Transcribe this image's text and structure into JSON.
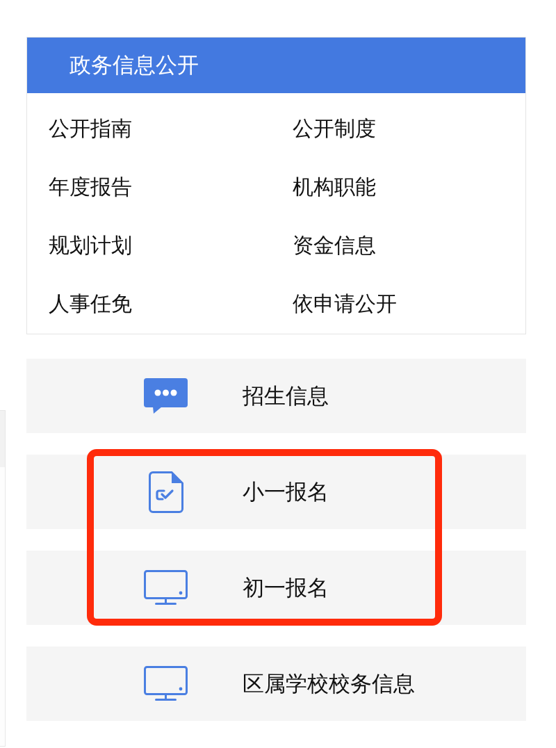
{
  "panel": {
    "title": "政务信息公开",
    "links": [
      "公开指南",
      "公开制度",
      "年度报告",
      "机构职能",
      "规划计划",
      "资金信息",
      "人事任免",
      "依申请公开"
    ]
  },
  "menu_items": [
    {
      "kind": "message",
      "label": "招生信息",
      "highlighted": false
    },
    {
      "kind": "form",
      "label": "小一报名",
      "highlighted": true
    },
    {
      "kind": "screen",
      "label": "初一报名",
      "highlighted": true
    },
    {
      "kind": "screen",
      "label": "区属学校校务信息",
      "highlighted": false
    }
  ]
}
